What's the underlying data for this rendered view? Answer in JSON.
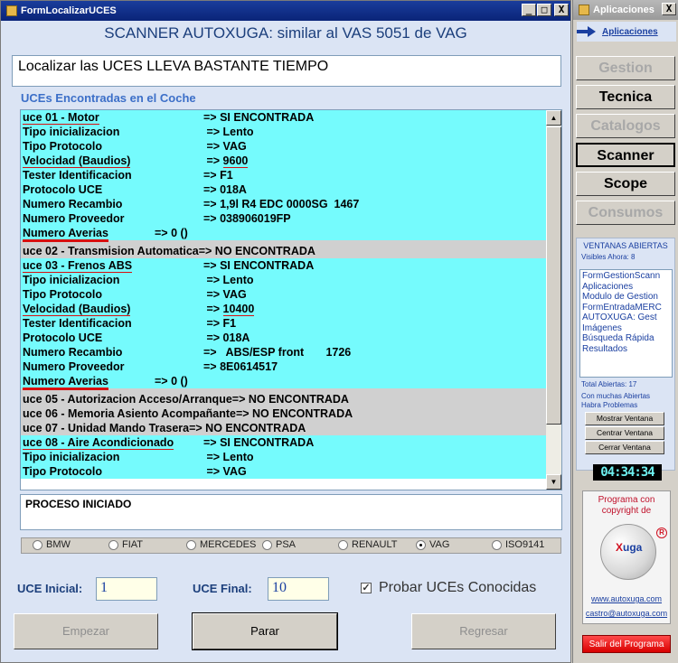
{
  "window": {
    "title": "FormLocalizarUCES",
    "header": "SCANNER AUTOXUGA: similar al VAS 5051 de VAG",
    "status_message": "Localizar las UCES  LLEVA BASTANTE TIEMPO",
    "section_label": "UCEs Encontradas en el Coche",
    "controls": {
      "minimize": "_",
      "maximize": "□",
      "close": "X"
    }
  },
  "uce_list": {
    "rows": [
      {
        "type": "found",
        "label": "uce 01 - Motor",
        "value": "=> SI ENCONTRADA",
        "ul_label": true
      },
      {
        "type": "found",
        "label": "Tipo inicializacion",
        "value": " => Lento"
      },
      {
        "type": "found",
        "label": "Tipo Protocolo",
        "value": " => VAG"
      },
      {
        "type": "found",
        "label": "Velocidad (Baudios)",
        "value": " => ",
        "extra": "9600",
        "ul_label": true,
        "ul_extra": true
      },
      {
        "type": "found",
        "label": "Tester Identificacion",
        "value": "=> F1"
      },
      {
        "type": "found",
        "label": "Protocolo UCE",
        "value": "=> 018A"
      },
      {
        "type": "found",
        "label": "Numero Recambio",
        "value": "=> 1,9l R4 EDC 0000SG  1467"
      },
      {
        "type": "found",
        "label": "Numero Proveedor",
        "value": "=> 038906019FP"
      },
      {
        "type": "found",
        "label": "Numero Averias",
        "value": "=> 0 ()",
        "ul_label": true,
        "short": true
      },
      {
        "type": "sep"
      },
      {
        "type": "notfound",
        "label": "uce 02 - Transmision Automatica",
        "value": "=> NO ENCONTRADA",
        "inline": true
      },
      {
        "type": "found",
        "label": "uce 03 - Frenos ABS",
        "value": "=> SI ENCONTRADA",
        "ul_label": true
      },
      {
        "type": "found",
        "label": "Tipo inicializacion",
        "value": " => Lento"
      },
      {
        "type": "found",
        "label": "Tipo Protocolo",
        "value": " => VAG"
      },
      {
        "type": "found",
        "label": "Velocidad (Baudios)",
        "value": " => ",
        "extra": "10400",
        "ul_label": true,
        "ul_extra": true
      },
      {
        "type": "found",
        "label": "Tester Identificacion",
        "value": " => F1"
      },
      {
        "type": "found",
        "label": "Protocolo UCE",
        "value": " => 018A"
      },
      {
        "type": "found",
        "label": "Numero Recambio",
        "value": "=>   ABS/ESP front       1726"
      },
      {
        "type": "found",
        "label": "Numero Proveedor",
        "value": "=> 8E0614517"
      },
      {
        "type": "found",
        "label": "Numero Averias",
        "value": "=> 0 ()",
        "ul_label": true,
        "short": true
      },
      {
        "type": "sep"
      },
      {
        "type": "notfound",
        "label": "uce 05 - Autorizacion Acceso/Arranque",
        "value": "=> NO ENCONTRADA",
        "inline": true
      },
      {
        "type": "notfound",
        "label": "uce 06 - Memoria Asiento Acompañante",
        "value": "=> NO ENCONTRADA",
        "inline": true
      },
      {
        "type": "notfound",
        "label": "uce 07 - Unidad Mando Trasera",
        "value": "=> NO ENCONTRADA",
        "inline": true
      },
      {
        "type": "found",
        "label": "uce 08 - Aire Acondicionado",
        "value": "=> SI ENCONTRADA",
        "ul_label": true
      },
      {
        "type": "found",
        "label": "Tipo inicializacion",
        "value": " => Lento"
      },
      {
        "type": "found",
        "label": "Tipo Protocolo",
        "value": " => VAG"
      }
    ]
  },
  "proceso": "PROCESO INICIADO",
  "brands": [
    {
      "label": "BMW",
      "selected": false
    },
    {
      "label": "FIAT",
      "selected": false
    },
    {
      "label": "MERCEDES",
      "selected": false
    },
    {
      "label": "PSA",
      "selected": false
    },
    {
      "label": "RENAULT",
      "selected": false
    },
    {
      "label": "VAG",
      "selected": true
    },
    {
      "label": "ISO9141",
      "selected": false
    }
  ],
  "form": {
    "uce_inicial_label": "UCE Inicial:",
    "uce_inicial_value": "1",
    "uce_final_label": "UCE Final:",
    "uce_final_value": "10",
    "probar_label": "Probar UCEs Conocidas",
    "probar_checked": "✓"
  },
  "buttons": {
    "empezar": "Empezar",
    "parar": "Parar",
    "regresar": "Regresar"
  },
  "side": {
    "title": "Aplicaciones",
    "close": "X",
    "sub_link": "Aplicaciones",
    "menu": [
      {
        "label": "Gestion",
        "state": "disabled"
      },
      {
        "label": "Tecnica",
        "state": "normal"
      },
      {
        "label": "Catalogos",
        "state": "disabled"
      },
      {
        "label": "Scanner",
        "state": "active"
      },
      {
        "label": "Scope",
        "state": "normal"
      },
      {
        "label": "Consumos",
        "state": "disabled"
      }
    ],
    "ventanas_title": "VENTANAS ABIERTAS",
    "visibles": "Visibles Ahora: 8",
    "open_windows": [
      "FormGestionScann",
      "Aplicaciones",
      "Modulo de Gestion",
      "FormEntradaMERC",
      "AUTOXUGA: Gest",
      "Imágenes",
      "Búsqueda Rápida",
      "Resultados"
    ],
    "total_abiertas": "Total Abiertas: 17",
    "warning": "Con muchas Abiertas Habra Problemas",
    "btn_mostrar": "Mostrar Ventana",
    "btn_centrar": "Centrar Ventana",
    "btn_cerrar": "Cerrar Ventana",
    "clock": "04:34:34",
    "copyright": "Programa con copyright de",
    "logo_x": "X",
    "logo_rest": "uga",
    "reg": "R",
    "link_web": "www.autoxuga.com",
    "link_mail": "castro@autoxuga.com",
    "salir": "Salir del Programa"
  }
}
